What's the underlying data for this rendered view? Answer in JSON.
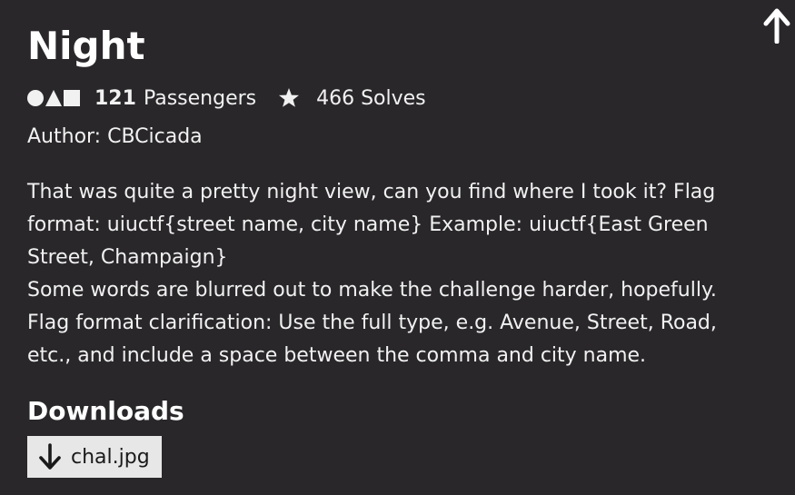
{
  "challenge": {
    "title": "Night",
    "passengers_count": "121",
    "passengers_label": "Passengers",
    "solves": "466 Solves",
    "author": "Author: CBCicada",
    "description": [
      "That was quite a pretty night view, can you find where I took it? Flag format: uiuctf{street name, city name} Example: uiuctf{East Green Street, Champaign}",
      "Some words are blurred out to make the challenge harder, hopefully. Flag format clarification: Use the full type, e.g. Avenue, Street, Road, etc., and include a space between the comma and city name."
    ]
  },
  "downloads": {
    "heading": "Downloads",
    "files": [
      {
        "name": "chal.jpg",
        "icon": "arrow-down-icon"
      }
    ]
  },
  "icons": {
    "scroll_top": "arrow-up-icon",
    "passengers": "shapes-icon",
    "solves": "star-icon"
  },
  "colors": {
    "background": "#29272a",
    "text": "#f1f1f1",
    "button_bg": "#e7e7e7",
    "button_text": "#1a1a1a"
  }
}
